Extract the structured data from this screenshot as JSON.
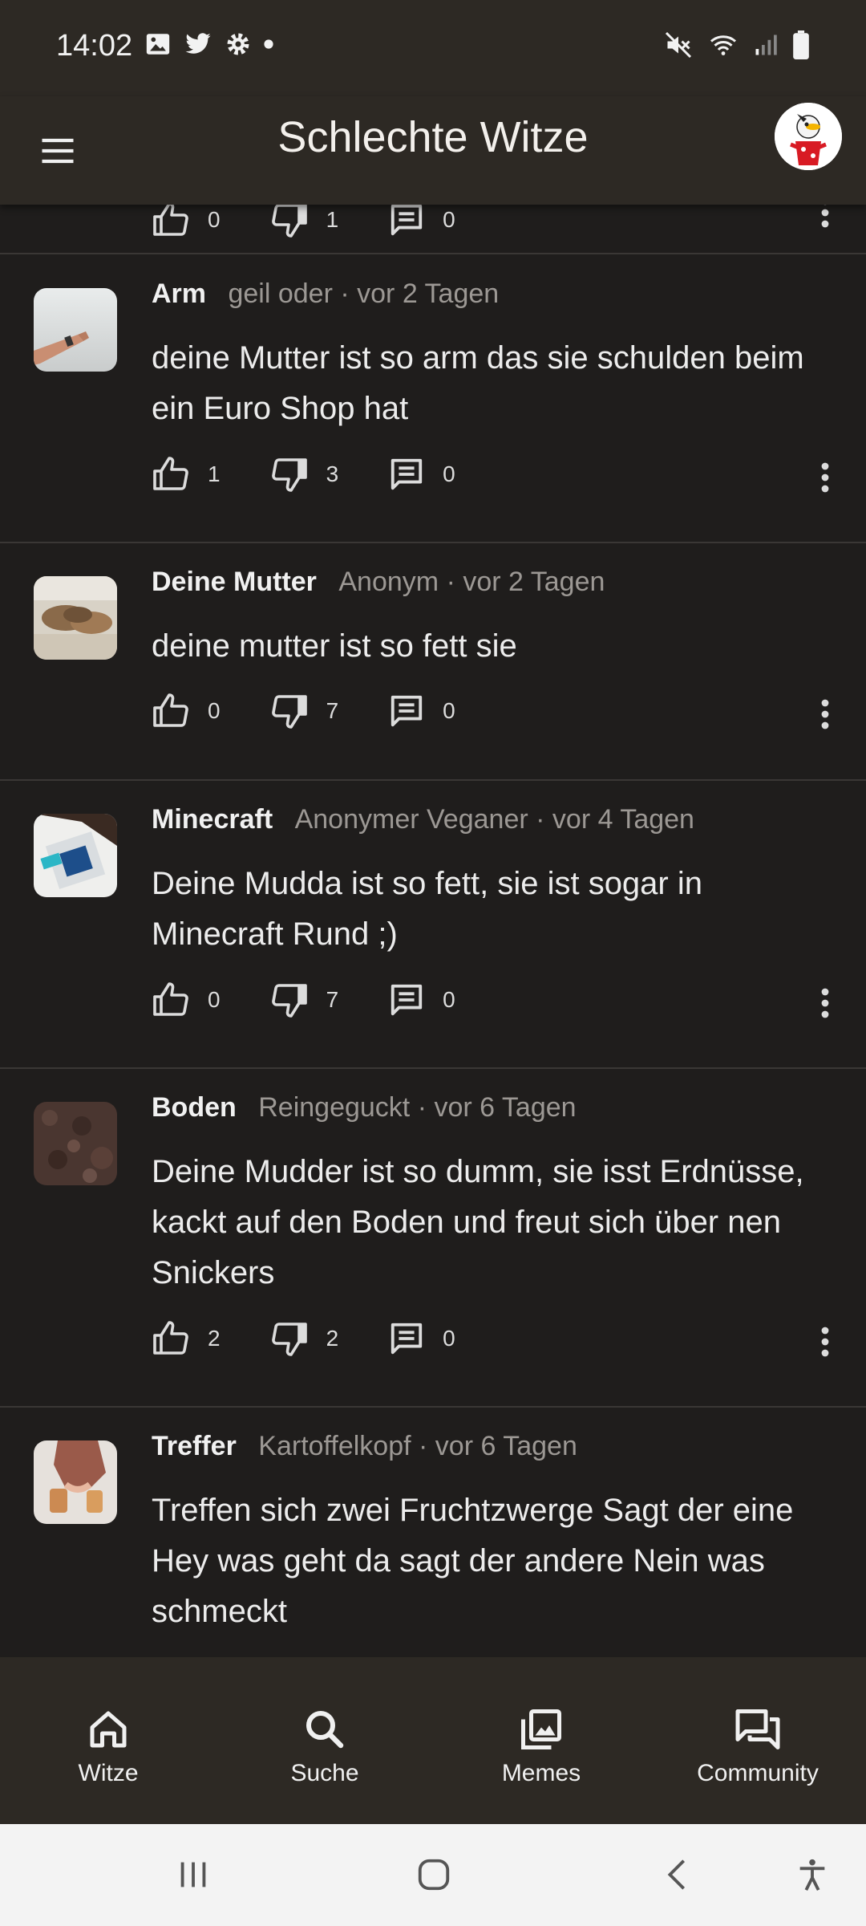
{
  "status_bar": {
    "time": "14:02",
    "left_icons": [
      "gallery-icon",
      "twitter-icon",
      "settings-icon",
      "dot-icon"
    ],
    "right_icons": [
      "mute-icon",
      "wifi-icon",
      "signal-icon",
      "battery-icon"
    ]
  },
  "app_bar": {
    "title": "Schlechte Witze"
  },
  "posts": [
    {
      "category": "Arm",
      "user": "geil oder",
      "time": "vor 2 Tagen",
      "text": "deine Mutter ist so arm das sie schulden beim ein Euro Shop hat",
      "likes": "1",
      "dislikes": "3",
      "comments": "0"
    },
    {
      "category": "Deine Mutter",
      "user": "Anonym",
      "time": "vor 2 Tagen",
      "text": "deine mutter ist so fett sie",
      "likes": "0",
      "dislikes": "7",
      "comments": "0"
    },
    {
      "category": "Minecraft",
      "user": "Anonymer Veganer",
      "time": "vor 4 Tagen",
      "text": "Deine Mudda ist so fett, sie ist sogar in Minecraft Rund ;)",
      "likes": "0",
      "dislikes": "7",
      "comments": "0"
    },
    {
      "category": "Boden",
      "user": "Reingeguckt",
      "time": "vor 6 Tagen",
      "text": "Deine Mudder ist so dumm, sie isst Erdnüsse, kackt auf den Boden und freut sich über nen Snickers",
      "likes": "2",
      "dislikes": "2",
      "comments": "0"
    },
    {
      "category": "Treffer",
      "user": "Kartoffelkopf",
      "time": "vor 6 Tagen",
      "text": "Treffen sich zwei Fruchtzwerge Sagt der eine Hey was geht da sagt der andere Nein was schmeckt"
    }
  ],
  "partial_post": {
    "likes": "0",
    "dislikes": "1",
    "comments": "0"
  },
  "bottom_nav": {
    "items": [
      {
        "label": "Witze",
        "icon": "home-icon"
      },
      {
        "label": "Suche",
        "icon": "search-icon"
      },
      {
        "label": "Memes",
        "icon": "image-icon"
      },
      {
        "label": "Community",
        "icon": "forum-icon"
      }
    ]
  },
  "colors": {
    "bar_background": "#2d2924",
    "feed_background": "#1f1d1c",
    "divider": "#3a3735",
    "secondary_text": "#9c9894"
  }
}
